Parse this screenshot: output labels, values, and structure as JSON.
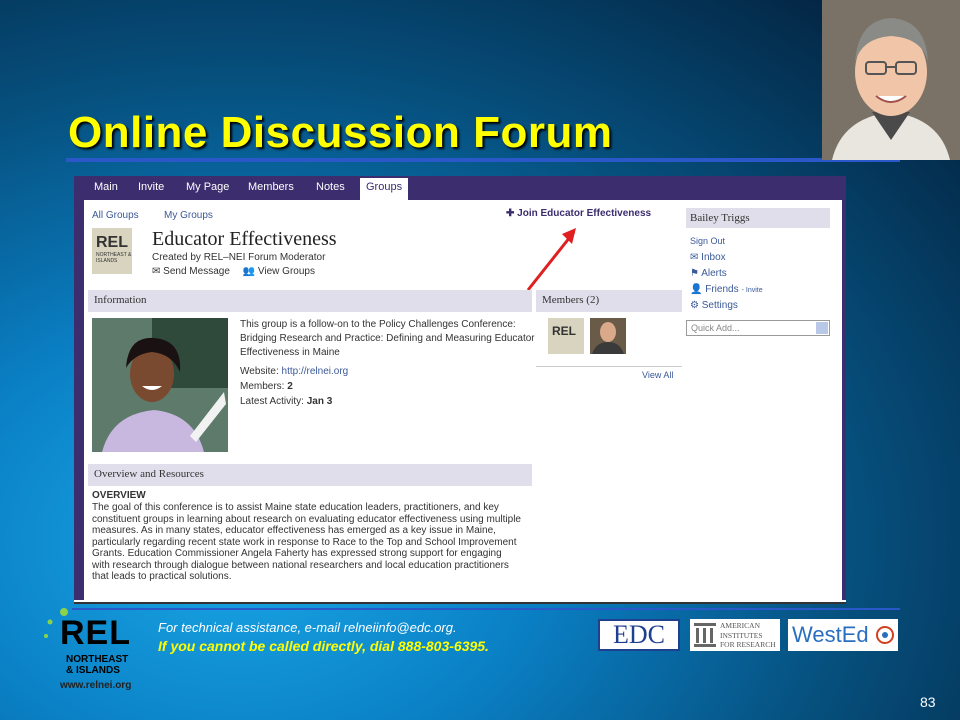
{
  "slide": {
    "title": "Online Discussion Forum",
    "page_number": "83"
  },
  "screenshot": {
    "nav": [
      "Main",
      "Invite",
      "My Page",
      "Members",
      "Notes",
      "Groups"
    ],
    "nav_active": "Groups",
    "breadcrumb": [
      "All Groups",
      "My Groups"
    ],
    "join_link": "Join Educator Effectiveness",
    "group_logo_text": "REL",
    "group_logo_sub": "NORTHEAST & ISLANDS",
    "group_title": "Educator Effectiveness",
    "group_created_by": "Created by REL–NEI Forum Moderator",
    "send_message": "Send Message",
    "view_groups": "View Groups",
    "information_header": "Information",
    "information_text": "This group is a follow-on to the Policy Challenges Conference: Bridging Research and Practice: Defining and Measuring Educator Effectiveness in Maine",
    "website_label": "Website:",
    "website_value": "http://relnei.org",
    "members_label": "Members:",
    "members_value": "2",
    "latest_label": "Latest Activity:",
    "latest_value": "Jan 3",
    "members_header": "Members (2)",
    "view_all": "View All",
    "user_name": "Bailey Triggs",
    "sign_out": "Sign Out",
    "user_menu": [
      "Inbox",
      "Alerts",
      "Friends",
      "Settings"
    ],
    "invite_label": "- Invite",
    "quick_add": "Quick Add...",
    "overview_header": "Overview and Resources",
    "overview_title": "OVERVIEW",
    "overview_text": "The goal of this conference is to assist Maine state education leaders, practitioners, and key constituent groups in learning about research on evaluating educator effectiveness using multiple measures. As in many states, educator effectiveness has emerged as a key issue in Maine, particularly regarding recent state work in response to Race to the Top and School Improvement Grants. Education Commissioner Angela Faherty has expressed strong support for engaging with research through dialogue between national researchers and local education practitioners that leads to practical solutions."
  },
  "footer": {
    "note": "For technical assistance, e-mail relneiinfo@edc.org.",
    "alert": "If you cannot be called directly, dial 888-803-6395.",
    "rel_logo": "REL",
    "rel_logo_sub1": "NORTHEAST",
    "rel_logo_sub2": "& ISLANDS",
    "rel_url": "www.relnei.org",
    "edc_logo": "EDC",
    "air_logo": [
      "AMERICAN",
      "INSTITUTES",
      "FOR RESEARCH"
    ],
    "wested_logo": "WestEd"
  },
  "colors": {
    "title": "#ffff00",
    "rule": "#2a58c8",
    "nav": "#3b2d6e",
    "arrow": "#e02020"
  }
}
